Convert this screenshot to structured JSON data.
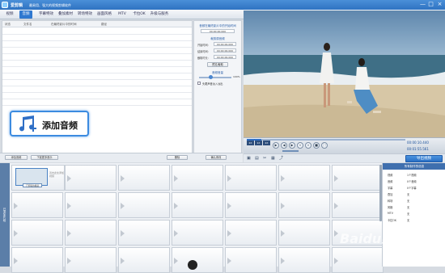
{
  "app": {
    "title": "爱剪辑",
    "slogan": "最易用、强大的视频剪辑软件"
  },
  "window": {
    "minimize": "—",
    "maximize": "□",
    "close": "×"
  },
  "tabs": [
    {
      "label": "视频"
    },
    {
      "label": "音频"
    },
    {
      "label": "字幕特效"
    },
    {
      "label": "叠加素材"
    },
    {
      "label": "转场特效"
    },
    {
      "label": "画面风格"
    },
    {
      "label": "MTV"
    },
    {
      "label": "卡拉OK"
    },
    {
      "label": "升级与服务"
    }
  ],
  "audio_list": {
    "columns": [
      "状态",
      "文件名",
      "在最终影片中的时间",
      "路径"
    ]
  },
  "bottom_bar": {
    "add_audio": "添加音频",
    "download_music": "下载更多音乐",
    "delete": "删除"
  },
  "callout": {
    "text": "添加音频"
  },
  "mid_panel": {
    "heading": "音频在最终影片中的开始时间",
    "start_time_value": "00:00:00.000",
    "section_clip": "裁剪原音频",
    "start_label": "开始时间：",
    "end_label": "结束时间：",
    "duration_label": "截取时长：",
    "time_zero": "00:00:00.000",
    "preview_btn": "预览/截取",
    "section_volume": "音频音量",
    "volume_pct": "100%",
    "fade_label": "头尾声音淡入淡出",
    "confirm_btn": "确认修改"
  },
  "controls": {
    "speed_2x": "2X",
    "speed_1x": "1X",
    "speed_half": "2X",
    "time_current": "00:00:10.440",
    "time_total": "00:01:55.561"
  },
  "toolbar2": {
    "export": "导出视频"
  },
  "timeline": {
    "side_label": "已添加片段",
    "thumb_label": "已剪辑的视频",
    "thumb_hint": "双击此处添加视频"
  },
  "info_panel": {
    "heading": "所有制作的信息",
    "rows": [
      {
        "k": "视频",
        "v": "1个视频"
      },
      {
        "k": "音频",
        "v": "0个音频"
      },
      {
        "k": "字幕",
        "v": "0个字幕"
      },
      {
        "k": "叠加",
        "v": "无"
      },
      {
        "k": "转场",
        "v": "无"
      },
      {
        "k": "风格",
        "v": "无"
      },
      {
        "k": "MTV",
        "v": "无"
      },
      {
        "k": "卡拉OK",
        "v": "无"
      }
    ]
  },
  "watermark": {
    "main": "Baidu经验",
    "sub": "jingyan.baidu.com"
  }
}
